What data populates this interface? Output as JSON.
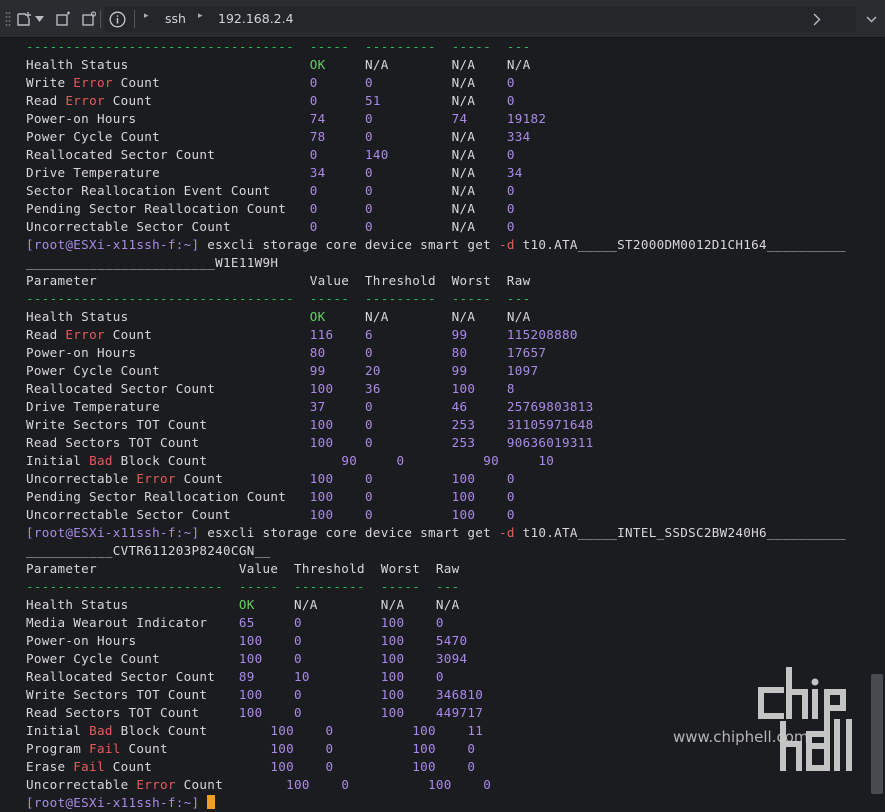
{
  "toolbar": {
    "address_items": [
      "ssh",
      "192.168.2.4"
    ]
  },
  "terminal": {
    "lines": [
      [
        {
          "t": "----------------------------------  -----  ---------  -----  ---",
          "c": "dash"
        }
      ],
      [
        {
          "t": "Health Status                       ",
          "c": ""
        },
        {
          "t": "OK",
          "c": "ok"
        },
        {
          "t": "     N/A        N/A    N/A",
          "c": ""
        }
      ],
      [
        {
          "t": "Write ",
          "c": ""
        },
        {
          "t": "Error",
          "c": "err"
        },
        {
          "t": " Count                   ",
          "c": ""
        },
        {
          "t": "0      0          ",
          "c": "val"
        },
        {
          "t": "N/A",
          "c": ""
        },
        {
          "t": "    0",
          "c": "val"
        }
      ],
      [
        {
          "t": "Read ",
          "c": ""
        },
        {
          "t": "Error",
          "c": "err"
        },
        {
          "t": " Count                    ",
          "c": ""
        },
        {
          "t": "0      51         ",
          "c": "val"
        },
        {
          "t": "N/A",
          "c": ""
        },
        {
          "t": "    0",
          "c": "val"
        }
      ],
      [
        {
          "t": "Power-on Hours                      ",
          "c": ""
        },
        {
          "t": "74     0          74     19182",
          "c": "val"
        }
      ],
      [
        {
          "t": "Power Cycle Count                   ",
          "c": ""
        },
        {
          "t": "78     0          ",
          "c": "val"
        },
        {
          "t": "N/A",
          "c": ""
        },
        {
          "t": "    334",
          "c": "val"
        }
      ],
      [
        {
          "t": "Reallocated Sector Count            ",
          "c": ""
        },
        {
          "t": "0      140        ",
          "c": "val"
        },
        {
          "t": "N/A",
          "c": ""
        },
        {
          "t": "    0",
          "c": "val"
        }
      ],
      [
        {
          "t": "Drive Temperature                   ",
          "c": ""
        },
        {
          "t": "34     0          ",
          "c": "val"
        },
        {
          "t": "N/A",
          "c": ""
        },
        {
          "t": "    34",
          "c": "val"
        }
      ],
      [
        {
          "t": "Sector Reallocation Event Count     ",
          "c": ""
        },
        {
          "t": "0      0          ",
          "c": "val"
        },
        {
          "t": "N/A",
          "c": ""
        },
        {
          "t": "    0",
          "c": "val"
        }
      ],
      [
        {
          "t": "Pending Sector Reallocation Count   ",
          "c": ""
        },
        {
          "t": "0      0          ",
          "c": "val"
        },
        {
          "t": "N/A",
          "c": ""
        },
        {
          "t": "    0",
          "c": "val"
        }
      ],
      [
        {
          "t": "Uncorrectable Sector Count          ",
          "c": ""
        },
        {
          "t": "0      0          ",
          "c": "val"
        },
        {
          "t": "N/A",
          "c": ""
        },
        {
          "t": "    0",
          "c": "val"
        }
      ],
      [
        {
          "t": "[root@ESXi-x11ssh-f:~]",
          "c": "prompt"
        },
        {
          "t": " esxcli storage core device smart get ",
          "c": ""
        },
        {
          "t": "-d",
          "c": "err"
        },
        {
          "t": " t10.ATA_____ST2000DM0012D1CH164__________",
          "c": ""
        }
      ],
      [
        {
          "t": "________________________W1E11W9H",
          "c": ""
        }
      ],
      [
        {
          "t": "Parameter                           Value  Threshold  Worst  Raw",
          "c": ""
        }
      ],
      [
        {
          "t": "----------------------------------  -----  ---------  -----  ---",
          "c": "dash"
        }
      ],
      [
        {
          "t": "Health Status                       ",
          "c": ""
        },
        {
          "t": "OK",
          "c": "ok"
        },
        {
          "t": "     N/A        N/A    N/A",
          "c": ""
        }
      ],
      [
        {
          "t": "Read ",
          "c": ""
        },
        {
          "t": "Error",
          "c": "err"
        },
        {
          "t": " Count                    ",
          "c": ""
        },
        {
          "t": "116    6          99     115208880",
          "c": "val"
        }
      ],
      [
        {
          "t": "Power-on Hours                      ",
          "c": ""
        },
        {
          "t": "80     0          80     17657",
          "c": "val"
        }
      ],
      [
        {
          "t": "Power Cycle Count                   ",
          "c": ""
        },
        {
          "t": "99     20         99     1097",
          "c": "val"
        }
      ],
      [
        {
          "t": "Reallocated Sector Count            ",
          "c": ""
        },
        {
          "t": "100    36         100    8",
          "c": "val"
        }
      ],
      [
        {
          "t": "Drive Temperature                   ",
          "c": ""
        },
        {
          "t": "37     0          46     25769803813",
          "c": "val"
        }
      ],
      [
        {
          "t": "Write Sectors TOT Count             ",
          "c": ""
        },
        {
          "t": "100    0          253    31105971648",
          "c": "val"
        }
      ],
      [
        {
          "t": "Read Sectors TOT Count              ",
          "c": ""
        },
        {
          "t": "100    0          253    90636019311",
          "c": "val"
        }
      ],
      [
        {
          "t": "Initial ",
          "c": ""
        },
        {
          "t": "Bad",
          "c": "err"
        },
        {
          "t": " Block Count                 ",
          "c": ""
        },
        {
          "t": "90     0          90     10",
          "c": "val"
        }
      ],
      [
        {
          "t": "Uncorrectable ",
          "c": ""
        },
        {
          "t": "Error",
          "c": "err"
        },
        {
          "t": " Count           ",
          "c": ""
        },
        {
          "t": "100    0          100    0",
          "c": "val"
        }
      ],
      [
        {
          "t": "Pending Sector Reallocation Count   ",
          "c": ""
        },
        {
          "t": "100    0          100    0",
          "c": "val"
        }
      ],
      [
        {
          "t": "Uncorrectable Sector Count          ",
          "c": ""
        },
        {
          "t": "100    0          100    0",
          "c": "val"
        }
      ],
      [
        {
          "t": "[root@ESXi-x11ssh-f:~]",
          "c": "prompt"
        },
        {
          "t": " esxcli storage core device smart get ",
          "c": ""
        },
        {
          "t": "-d",
          "c": "err"
        },
        {
          "t": " t10.ATA_____INTEL_SSDSC2BW240H6__________",
          "c": ""
        }
      ],
      [
        {
          "t": "___________CVTR611203P8240CGN__",
          "c": ""
        }
      ],
      [
        {
          "t": "Parameter                  Value  Threshold  Worst  Raw",
          "c": ""
        }
      ],
      [
        {
          "t": "-------------------------  -----  ---------  -----  ---",
          "c": "dash"
        }
      ],
      [
        {
          "t": "Health Status              ",
          "c": ""
        },
        {
          "t": "OK",
          "c": "ok"
        },
        {
          "t": "     N/A        N/A    N/A",
          "c": ""
        }
      ],
      [
        {
          "t": "Media Wearout Indicator    ",
          "c": ""
        },
        {
          "t": "65     0          100    0",
          "c": "val"
        }
      ],
      [
        {
          "t": "Power-on Hours             ",
          "c": ""
        },
        {
          "t": "100    0          100    5470",
          "c": "val"
        }
      ],
      [
        {
          "t": "Power Cycle Count          ",
          "c": ""
        },
        {
          "t": "100    0          100    3094",
          "c": "val"
        }
      ],
      [
        {
          "t": "Reallocated Sector Count   ",
          "c": ""
        },
        {
          "t": "89     10         100    0",
          "c": "val"
        }
      ],
      [
        {
          "t": "Write Sectors TOT Count    ",
          "c": ""
        },
        {
          "t": "100    0          100    346810",
          "c": "val"
        }
      ],
      [
        {
          "t": "Read Sectors TOT Count     ",
          "c": ""
        },
        {
          "t": "100    0          100    449717",
          "c": "val"
        }
      ],
      [
        {
          "t": "Initial ",
          "c": ""
        },
        {
          "t": "Bad",
          "c": "err"
        },
        {
          "t": " Block Count        ",
          "c": ""
        },
        {
          "t": "100    0          100    11",
          "c": "val"
        }
      ],
      [
        {
          "t": "Program ",
          "c": ""
        },
        {
          "t": "Fail",
          "c": "err"
        },
        {
          "t": " Count             ",
          "c": ""
        },
        {
          "t": "100    0          100    0",
          "c": "val"
        }
      ],
      [
        {
          "t": "Erase ",
          "c": ""
        },
        {
          "t": "Fail",
          "c": "err"
        },
        {
          "t": " Count               ",
          "c": ""
        },
        {
          "t": "100    0          100    0",
          "c": "val"
        }
      ],
      [
        {
          "t": "Uncorrectable ",
          "c": ""
        },
        {
          "t": "Error",
          "c": "err"
        },
        {
          "t": " Count        ",
          "c": ""
        },
        {
          "t": "100    0          100    0",
          "c": "val"
        }
      ],
      [
        {
          "t": "[root@ESXi-x11ssh-f:~]",
          "c": "prompt"
        },
        {
          "t": " ",
          "c": ""
        }
      ]
    ]
  },
  "watermark": {
    "logo_text": "chiphell",
    "site_text": "www.chiphell.com"
  },
  "colors": {
    "value": "#a98ae8",
    "ok": "#5fd35f",
    "error": "#e85a5a",
    "dash": "#2fb85a",
    "cursor": "#f0a020"
  }
}
